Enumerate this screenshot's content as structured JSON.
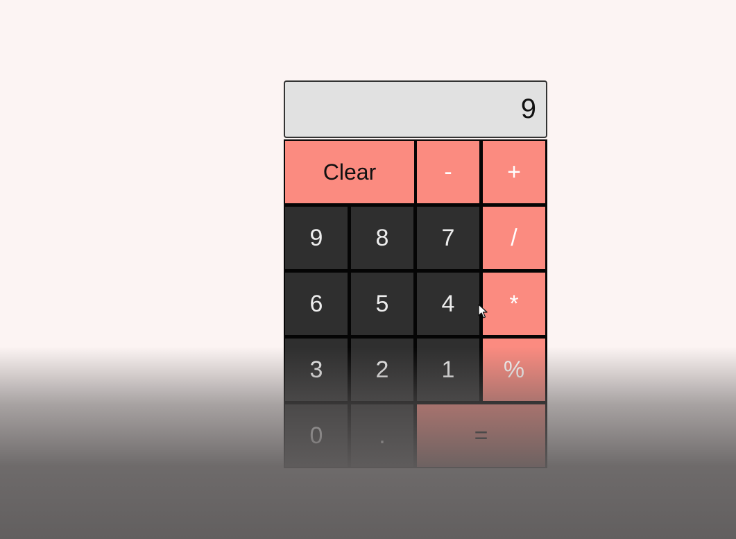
{
  "display": {
    "value": "9"
  },
  "keys": {
    "clear": "Clear",
    "minus": "-",
    "plus": "+",
    "divide": "/",
    "multiply": "*",
    "percent": "%",
    "equals": "=",
    "decimal": ".",
    "d0": "0",
    "d1": "1",
    "d2": "2",
    "d3": "3",
    "d4": "4",
    "d5": "5",
    "d6": "6",
    "d7": "7",
    "d8": "8",
    "d9": "9"
  },
  "colors": {
    "accent": "#fb8b80",
    "digit_key": "#2f2f2f",
    "display_bg": "#e1e1e1",
    "page_bg": "#fcf4f3"
  },
  "icons": {
    "pointer": "mouse-cursor-icon"
  }
}
